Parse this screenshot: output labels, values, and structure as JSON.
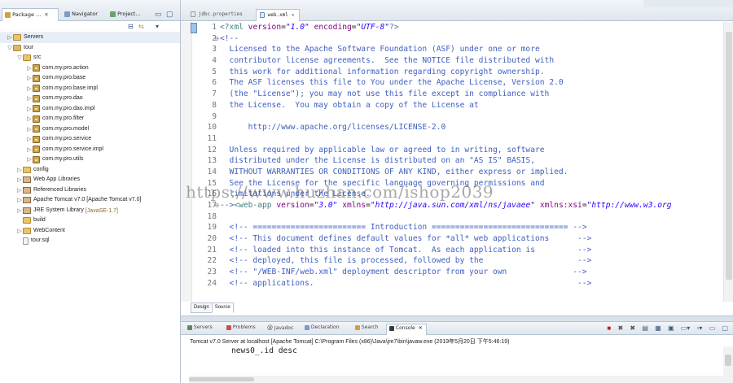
{
  "explorer": {
    "tabs": [
      {
        "label": "Package ..."
      },
      {
        "label": "Navigator"
      },
      {
        "label": "Project..."
      }
    ],
    "tree": [
      {
        "label": "Servers",
        "icon": "folder",
        "indent": 0,
        "arrow": "▷",
        "selected": true
      },
      {
        "label": "tour",
        "icon": "project",
        "indent": 0,
        "arrow": "▽"
      },
      {
        "label": "src",
        "icon": "source-folder",
        "indent": 1,
        "arrow": "▽"
      },
      {
        "label": "com.my.pro.action",
        "icon": "package",
        "indent": 2,
        "arrow": "▷"
      },
      {
        "label": "com.my.pro.base",
        "icon": "package",
        "indent": 2,
        "arrow": "▷"
      },
      {
        "label": "com.my.pro.base.impl",
        "icon": "package",
        "indent": 2,
        "arrow": "▷"
      },
      {
        "label": "com.my.pro.dao",
        "icon": "package",
        "indent": 2,
        "arrow": "▷"
      },
      {
        "label": "com.my.pro.dao.impl",
        "icon": "package",
        "indent": 2,
        "arrow": "▷"
      },
      {
        "label": "com.my.pro.filter",
        "icon": "package",
        "indent": 2,
        "arrow": "▷"
      },
      {
        "label": "com.my.pro.model",
        "icon": "package",
        "indent": 2,
        "arrow": "▷"
      },
      {
        "label": "com.my.pro.service",
        "icon": "package",
        "indent": 2,
        "arrow": "▷"
      },
      {
        "label": "com.my.pro.service.impl",
        "icon": "package",
        "indent": 2,
        "arrow": "▷"
      },
      {
        "label": "com.my.pro.utils",
        "icon": "package",
        "indent": 2,
        "arrow": "▷"
      },
      {
        "label": "config",
        "icon": "folder",
        "indent": 1,
        "arrow": "▷"
      },
      {
        "label": "Web App Libraries",
        "icon": "library",
        "indent": 1,
        "arrow": "▷"
      },
      {
        "label": "Referenced Libraries",
        "icon": "library",
        "indent": 1,
        "arrow": "▷"
      },
      {
        "label": "Apache Tomcat v7.0 [Apache Tomcat v7.0]",
        "icon": "library",
        "indent": 1,
        "arrow": "▷"
      },
      {
        "label": "JRE System Library",
        "icon": "library",
        "indent": 1,
        "arrow": "▷",
        "decoration": "[JavaSE-1.7]"
      },
      {
        "label": "build",
        "icon": "folder",
        "indent": 1,
        "arrow": ""
      },
      {
        "label": "WebContent",
        "icon": "folder",
        "indent": 1,
        "arrow": "▷"
      },
      {
        "label": "tour.sql",
        "icon": "file",
        "indent": 1,
        "arrow": ""
      }
    ]
  },
  "editor": {
    "tabs": [
      {
        "label": "jdbc.properties",
        "active": false
      },
      {
        "label": "web.xml",
        "active": true
      }
    ],
    "bottom_tabs": [
      "Design",
      "Source"
    ],
    "lines": [
      {
        "n": "1",
        "fold": "",
        "html": "<span class=\"pi\">&lt;?xml</span> <span class=\"an\">version</span>=<span class=\"av\">\"1.0\"</span> <span class=\"an\">encoding</span>=<span class=\"av\">\"UTF-8\"</span><span class=\"pi\">?&gt;</span>"
      },
      {
        "n": "2",
        "fold": "⊖",
        "html": "<span class=\"cm\">&lt;!--</span>"
      },
      {
        "n": "3",
        "fold": "",
        "html": "<span class=\"cm\">  Licensed to the Apache Software Foundation (ASF) under one or more</span>"
      },
      {
        "n": "4",
        "fold": "",
        "html": "<span class=\"cm\">  contributor license agreements.  See the NOTICE file distributed with</span>"
      },
      {
        "n": "5",
        "fold": "",
        "html": "<span class=\"cm\">  this work for additional information regarding copyright ownership.</span>"
      },
      {
        "n": "6",
        "fold": "",
        "html": "<span class=\"cm\">  The ASF licenses this file to You under the Apache License, Version 2.0</span>"
      },
      {
        "n": "7",
        "fold": "",
        "html": "<span class=\"cm\">  (the \"License\"); you may not use this file except in compliance with</span>"
      },
      {
        "n": "8",
        "fold": "",
        "html": "<span class=\"cm\">  the License.  You may obtain a copy of the License at</span>"
      },
      {
        "n": "9",
        "fold": "",
        "html": ""
      },
      {
        "n": "10",
        "fold": "",
        "html": "<span class=\"cm\">      http://www.apache.org/licenses/LICENSE-2.0</span>"
      },
      {
        "n": "11",
        "fold": "",
        "html": ""
      },
      {
        "n": "12",
        "fold": "",
        "html": "<span class=\"cm\">  Unless required by applicable law or agreed to in writing, software</span>"
      },
      {
        "n": "13",
        "fold": "",
        "html": "<span class=\"cm\">  distributed under the License is distributed on an \"AS IS\" BASIS,</span>"
      },
      {
        "n": "14",
        "fold": "",
        "html": "<span class=\"cm\">  WITHOUT WARRANTIES OR CONDITIONS OF ANY KIND, either express or implied.</span>"
      },
      {
        "n": "15",
        "fold": "",
        "html": "<span class=\"cm\">  See the License for the specific language governing permissions and</span>"
      },
      {
        "n": "16",
        "fold": "",
        "html": "<span class=\"cm\">  limitations under the License.</span>"
      },
      {
        "n": "17",
        "fold": "⊖",
        "html": "<span class=\"cm\">--&gt;</span><span class=\"tg\">&lt;web-app</span> <span class=\"an\">version</span>=<span class=\"av\">\"3.0\"</span> <span class=\"an\">xmlns</span>=<span class=\"av\">\"http://java.sun.com/xml/ns/javaee\"</span> <span class=\"an\">xmlns:xsi</span>=<span class=\"av\">\"http://www.w3.org</span>"
      },
      {
        "n": "18",
        "fold": "",
        "html": ""
      },
      {
        "n": "19",
        "fold": "",
        "html": "<span class=\"cm\">  &lt;!-- ======================== Introduction ============================= --&gt;</span>"
      },
      {
        "n": "20",
        "fold": "",
        "html": "<span class=\"cm\">  &lt;!-- This document defines default values for *all* web applications      --&gt;</span>"
      },
      {
        "n": "21",
        "fold": "",
        "html": "<span class=\"cm\">  &lt;!-- loaded into this instance of Tomcat.  As each application is         --&gt;</span>"
      },
      {
        "n": "22",
        "fold": "",
        "html": "<span class=\"cm\">  &lt;!-- deployed, this file is processed, followed by the                    --&gt;</span>"
      },
      {
        "n": "23",
        "fold": "",
        "html": "<span class=\"cm\">  &lt;!-- \"/WEB-INF/web.xml\" deployment descriptor from your own              --&gt;</span>"
      },
      {
        "n": "24",
        "fold": "",
        "html": "<span class=\"cm\">  &lt;!-- applications.                                                        --&gt;</span>"
      }
    ]
  },
  "watermark": "https://www.huzhan.com/ishop2039",
  "console": {
    "tabs": [
      {
        "label": "Servers",
        "active": false
      },
      {
        "label": "Problems",
        "active": false
      },
      {
        "label": "Javadoc",
        "active": false
      },
      {
        "label": "Declaration",
        "active": false
      },
      {
        "label": "Search",
        "active": false
      },
      {
        "label": "Console",
        "active": true
      }
    ],
    "status": "Tomcat v7.0 Server at localhost [Apache Tomcat] C:\\Program Files (x86)\\Java\\jre7\\bin\\javaw.exe (2019年5月20日 下午5:46:19)",
    "output": "news0_.id desc"
  }
}
